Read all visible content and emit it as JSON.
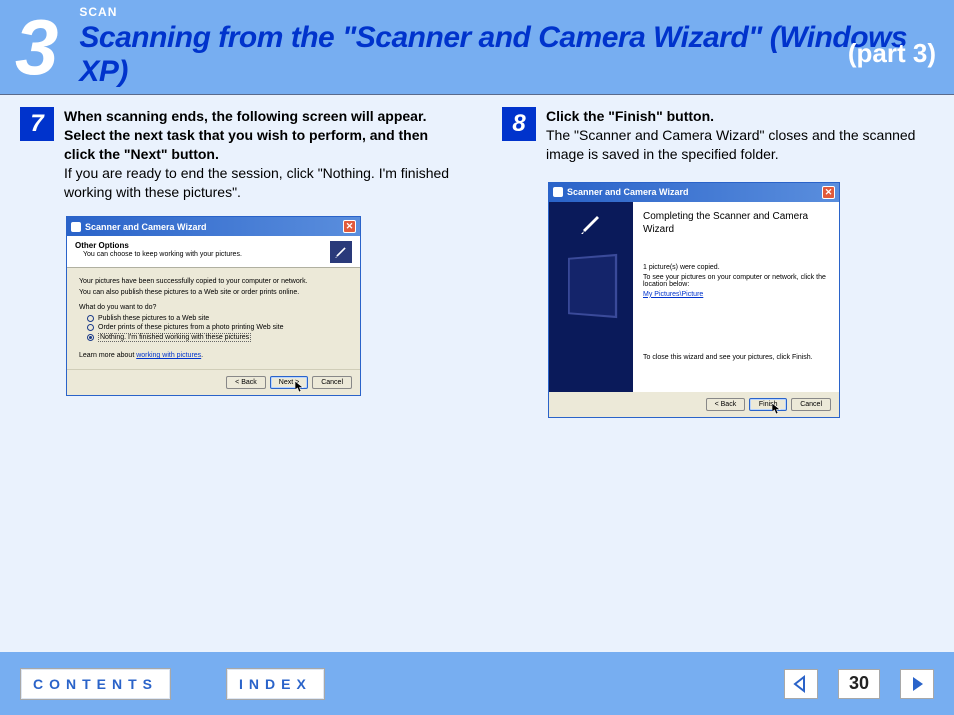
{
  "header": {
    "chapter": "3",
    "overline": "SCAN",
    "title": "Scanning from the \"Scanner and Camera Wizard\" (Windows XP)",
    "part": "(part 3)"
  },
  "step7": {
    "num": "7",
    "bold": "When scanning ends, the following screen will appear. Select the next task that you wish to perform, and then click the \"Next\" button.",
    "normal": "If you are ready to end the session, click \"Nothing. I'm finished working with these pictures\".",
    "wizard": {
      "title": "Scanner and Camera Wizard",
      "h1": "Other Options",
      "h2": "You can choose to keep working with your pictures.",
      "body1": "Your pictures have been successfully copied to your computer or network.",
      "body2": "You can also publish these pictures to a Web site or order prints online.",
      "q": "What do you want to do?",
      "opt1": "Publish these pictures to a Web site",
      "opt2": "Order prints of these pictures from a photo printing Web site",
      "opt3": "Nothing. I'm finished working with these pictures",
      "learn": "Learn more about ",
      "learn_link": "working with pictures",
      "back": "< Back",
      "next": "Next >",
      "cancel": "Cancel"
    }
  },
  "step8": {
    "num": "8",
    "bold": "Click the \"Finish\" button.",
    "normal": "The \"Scanner and Camera Wizard\" closes and the scanned image is saved in the specified folder.",
    "wizard": {
      "title": "Scanner and Camera Wizard",
      "h": "Completing the Scanner and Camera Wizard",
      "copied": "1 picture(s) were copied.",
      "seeline": "To see your pictures on your computer or network, click the location below:",
      "link": "My Pictures\\Picture",
      "closenote": "To close this wizard and see your pictures, click Finish.",
      "back": "< Back",
      "finish": "Finish",
      "cancel": "Cancel"
    }
  },
  "footer": {
    "contents": "CONTENTS",
    "index": "INDEX",
    "page": "30"
  }
}
